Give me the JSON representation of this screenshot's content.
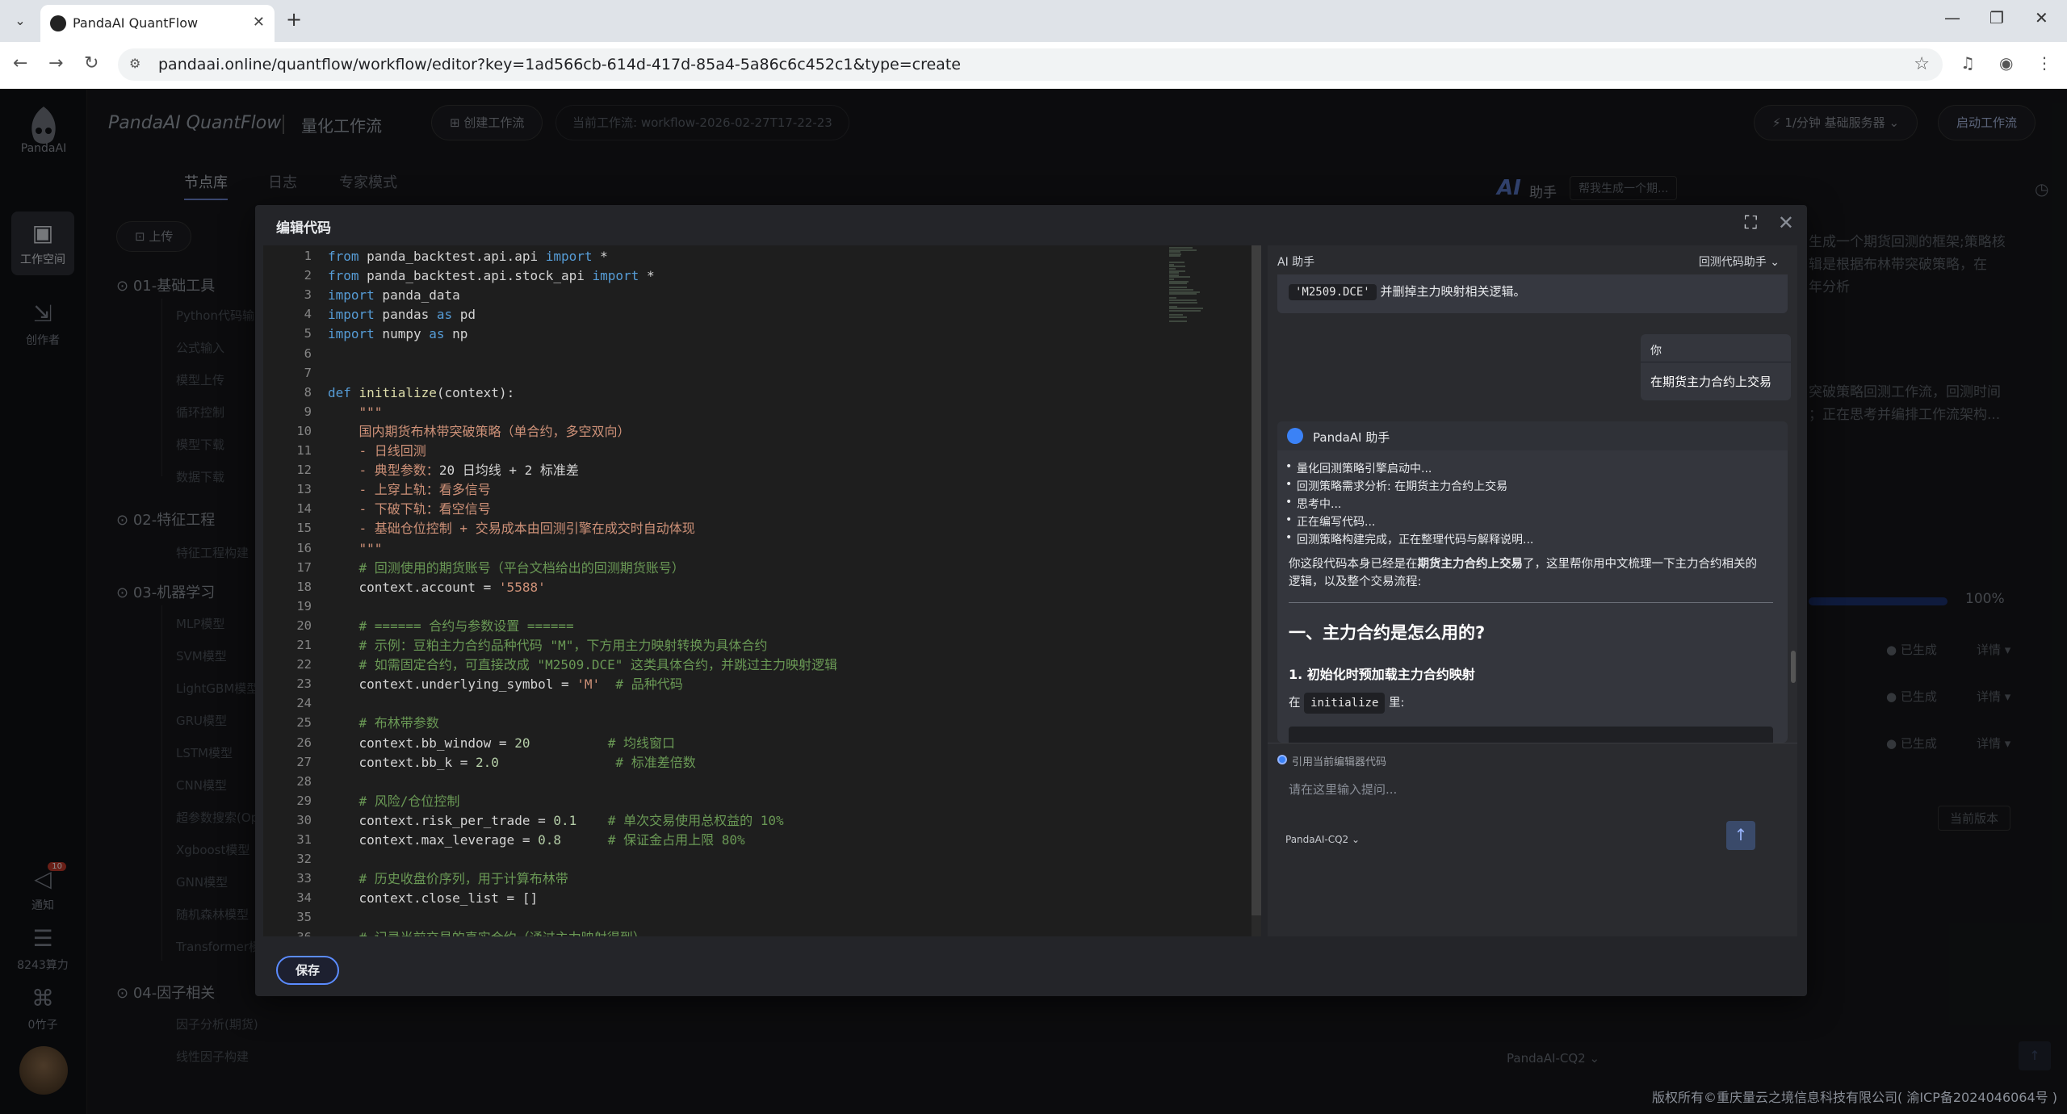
{
  "browser": {
    "tab_title": "PandaAI QuantFlow",
    "url": "pandaai.online/quantflow/workflow/editor?key=1ad566cb-614d-417d-85a4-5a86c6c452c1&type=create"
  },
  "sidebar": {
    "logo_text": "PandaAI",
    "items": [
      {
        "label": "工作空间",
        "icon": "workspace-icon"
      },
      {
        "label": "创作者",
        "icon": "creator-icon"
      },
      {
        "label": "通知",
        "icon": "notify-icon",
        "badge": "10"
      },
      {
        "label": "8243算力",
        "icon": "compute-icon"
      },
      {
        "label": "0竹子",
        "icon": "bamboo-icon"
      }
    ]
  },
  "topbar": {
    "brand": "PandaAI QuantFlow",
    "brand_sub": "量化工作流",
    "create_btn": "创建工作流",
    "current_wf": "当前工作流:   workflow-2026-02-27T17-22-23",
    "server": "1/分钟  基础服务器",
    "start_btn": "启动工作流"
  },
  "subnav": [
    "节点库",
    "日志",
    "专家模式"
  ],
  "nodelib": {
    "upload": "上传",
    "groups": [
      {
        "label": "01-基础工具",
        "items": [
          "Python代码输入",
          "公式输入",
          "模型上传",
          "循环控制",
          "模型下载",
          "数据下载"
        ]
      },
      {
        "label": "02-特征工程",
        "items": [
          "特征工程构建"
        ]
      },
      {
        "label": "03-机器学习",
        "items": [
          "MLP模型",
          "SVM模型",
          "LightGBM模型",
          "GRU模型",
          "LSTM模型",
          "CNN模型",
          "超参数搜索(Op",
          "Xgboost模型",
          "GNN模型",
          "随机森林模型",
          "Transformer模"
        ]
      },
      {
        "label": "04-因子相关",
        "items": [
          "因子分析(期货)",
          "线性因子构建"
        ]
      }
    ]
  },
  "rightpanel": {
    "ai_label": "AI",
    "assistant": "助手",
    "tab": "帮我生成一个期...",
    "text1": [
      "生成一个期货回测的框架;策略核",
      "辑是根据布林带突破策略，在",
      "年分析"
    ],
    "text2": [
      "突破策略回测工作流，回测时间",
      "；正在思考并编排工作流架构..."
    ],
    "progress": "100%",
    "status_rows": [
      "已生成",
      "已生成",
      "已生成"
    ],
    "detail": "详情",
    "version": "当前版本",
    "model": "PandaAI-CQ2"
  },
  "modal": {
    "title": "编辑代码",
    "save": "保存",
    "code_lines": [
      [
        [
          "kw",
          "from"
        ],
        [
          "t",
          " panda_backtest.api.api "
        ],
        [
          "kw",
          "import"
        ],
        [
          "t",
          " *"
        ]
      ],
      [
        [
          "kw",
          "from"
        ],
        [
          "t",
          " panda_backtest.api.stock_api "
        ],
        [
          "kw",
          "import"
        ],
        [
          "t",
          " *"
        ]
      ],
      [
        [
          "kw",
          "import"
        ],
        [
          "t",
          " panda_data"
        ]
      ],
      [
        [
          "kw",
          "import"
        ],
        [
          "t",
          " pandas "
        ],
        [
          "kw",
          "as"
        ],
        [
          "t",
          " pd"
        ]
      ],
      [
        [
          "kw",
          "import"
        ],
        [
          "t",
          " numpy "
        ],
        [
          "kw",
          "as"
        ],
        [
          "t",
          " np"
        ]
      ],
      [],
      [],
      [
        [
          "kw",
          "def"
        ],
        [
          "t",
          " "
        ],
        [
          "fn",
          "initialize"
        ],
        [
          "t",
          "(context):"
        ]
      ],
      [
        [
          "str",
          "    \"\"\""
        ]
      ],
      [
        [
          "str",
          "    国内期货布林带突破策略（单合约，多空双向）"
        ]
      ],
      [
        [
          "str",
          "    - 日线回测"
        ]
      ],
      [
        [
          "str",
          "    - 典型参数："
        ],
        [
          "t",
          "20 日均线 + 2 标准差"
        ]
      ],
      [
        [
          "str",
          "    - 上穿上轨：看多信号"
        ]
      ],
      [
        [
          "str",
          "    - 下破下轨：看空信号"
        ]
      ],
      [
        [
          "str",
          "    - 基础仓位控制 + 交易成本由回测引擎在成交时自动体现"
        ]
      ],
      [
        [
          "str",
          "    \"\"\""
        ]
      ],
      [
        [
          "cm",
          "    # 回测使用的期货账号（平台文档给出的回测期货账号）"
        ]
      ],
      [
        [
          "t",
          "    context.account = "
        ],
        [
          "str",
          "'5588'"
        ]
      ],
      [],
      [
        [
          "cm",
          "    # ====== 合约与参数设置 ======"
        ]
      ],
      [
        [
          "cm",
          "    # 示例：豆粕主力合约品种代码 \"M\"，下方用主力映射转换为具体合约"
        ]
      ],
      [
        [
          "cm",
          "    # 如需固定合约，可直接改成 \"M2509.DCE\" 这类具体合约，并跳过主力映射逻辑"
        ]
      ],
      [
        [
          "t",
          "    context.underlying_symbol = "
        ],
        [
          "str",
          "'M'"
        ],
        [
          "cm",
          "  # 品种代码"
        ]
      ],
      [],
      [
        [
          "cm",
          "    # 布林带参数"
        ]
      ],
      [
        [
          "t",
          "    context.bb_window = "
        ],
        [
          "num",
          "20"
        ],
        [
          "cm",
          "          # 均线窗口"
        ]
      ],
      [
        [
          "t",
          "    context.bb_k = "
        ],
        [
          "num",
          "2.0"
        ],
        [
          "cm",
          "               # 标准差倍数"
        ]
      ],
      [],
      [
        [
          "cm",
          "    # 风险/仓位控制"
        ]
      ],
      [
        [
          "t",
          "    context.risk_per_trade = "
        ],
        [
          "num",
          "0.1"
        ],
        [
          "cm",
          "    # 单次交易使用总权益的 10%"
        ]
      ],
      [
        [
          "t",
          "    context.max_leverage = "
        ],
        [
          "num",
          "0.8"
        ],
        [
          "cm",
          "      # 保证金占用上限 80%"
        ]
      ],
      [],
      [
        [
          "cm",
          "    # 历史收盘价序列，用于计算布林带"
        ]
      ],
      [
        [
          "t",
          "    context.close_list = []"
        ]
      ],
      [],
      [
        [
          "cm",
          "    # 记录当前交易的真实合约（通过主力映射得到）"
        ]
      ]
    ]
  },
  "ai": {
    "title": "AI 助手",
    "mode": "回测代码助手",
    "top_code": "'M2509.DCE'",
    "top_text": "并删掉主力映射相关逻辑。",
    "user_name": "你",
    "user_msg": "在期货主力合约上交易",
    "bot_name": "PandaAI 助手",
    "steps": [
      "量化回测策略引擎启动中...",
      "回测策略需求分析:  在期货主力合约上交易",
      "思考中...",
      "正在编写代码...",
      "回测策略构建完成，正在整理代码与解释说明..."
    ],
    "para_a": "你这段代码本身已经是在",
    "para_b": "期货主力合约上交易",
    "para_c": "了，这里帮你用中文梳理一下主力合约相关的",
    "para_d": "逻辑，以及整个交易流程:",
    "h1": "一、主力合约是怎么用的?",
    "h3": "1. 初始化时预加载主力合约映射",
    "in_a": "在",
    "in_code": "initialize",
    "in_b": "里:",
    "ref": "引用当前编辑器代码",
    "placeholder": "请在这里输入提问...",
    "model": "PandaAI-CQ2"
  },
  "copyright": "版权所有©重庆量云之境信息科技有限公司( 渝ICP备2024046064号 )"
}
